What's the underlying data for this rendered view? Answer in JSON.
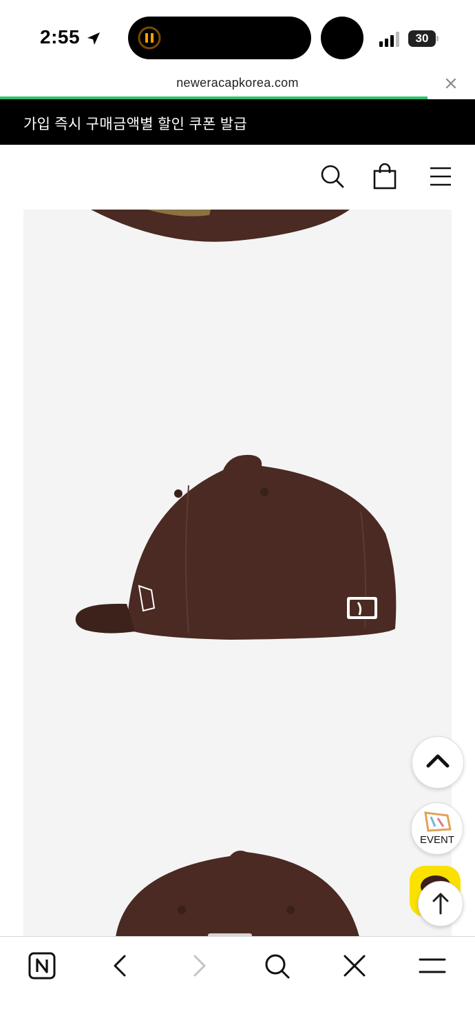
{
  "status_bar": {
    "time": "2:55",
    "battery": "30",
    "icons": [
      "location-arrow-icon",
      "pause-icon",
      "signal-icon",
      "battery-icon"
    ]
  },
  "browser": {
    "url": "neweracapkorea.com",
    "load_progress": 0.9,
    "accent_color": "#2fc36b"
  },
  "promo_banner": {
    "text": "가입 즉시 구매금액별 할인 쿠폰 발급"
  },
  "header": {
    "icons": [
      "search-icon",
      "shopping-bag-icon",
      "menu-icon"
    ]
  },
  "product_gallery": {
    "background": "#f4f4f4",
    "cap_color": "#4a2a22",
    "images": [
      "cap-front-view",
      "cap-side-view",
      "cap-back-view"
    ]
  },
  "floating": {
    "scroll_up_icon": "chevron-up-icon",
    "event_label": "EVENT",
    "top_icon": "arrow-up-icon"
  },
  "toolbar": {
    "icons": [
      "naver-home-icon",
      "back-icon",
      "forward-icon",
      "search-icon",
      "close-icon",
      "menu-icon"
    ]
  }
}
